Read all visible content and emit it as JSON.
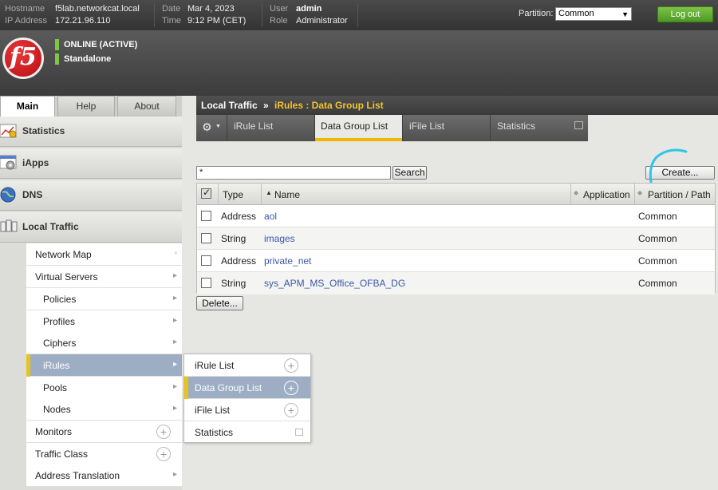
{
  "topbar": {
    "hostname_label": "Hostname",
    "hostname": "f5lab.networkcat.local",
    "ip_label": "IP Address",
    "ip": "172.21.96.110",
    "date_label": "Date",
    "date": "Mar 4, 2023",
    "time_label": "Time",
    "time": "9:12 PM (CET)",
    "user_label": "User",
    "user": "admin",
    "role_label": "Role",
    "role": "Administrator",
    "partition_label": "Partition:",
    "partition_value": "Common",
    "logout_label": "Log out"
  },
  "header": {
    "logo_text": "f5",
    "status_1": "ONLINE (ACTIVE)",
    "status_2": "Standalone"
  },
  "main_tabs": [
    "Main",
    "Help",
    "About"
  ],
  "sidebar": {
    "sections": [
      "Statistics",
      "iApps",
      "DNS",
      "Local Traffic"
    ],
    "items": [
      "Network Map",
      "Virtual Servers",
      "Policies",
      "Profiles",
      "Ciphers",
      "iRules",
      "Pools",
      "Nodes",
      "Monitors",
      "Traffic Class",
      "Address Translation"
    ]
  },
  "flyout": {
    "items": [
      "iRule List",
      "Data Group List",
      "iFile List",
      "Statistics"
    ]
  },
  "breadcrumb": {
    "root": "Local Traffic",
    "sep": "»",
    "current": "iRules : Data Group List"
  },
  "subtabs": [
    "iRule List",
    "Data Group List",
    "iFile List",
    "Statistics"
  ],
  "search": {
    "value": "*",
    "button": "Search"
  },
  "create_button": "Create...",
  "table": {
    "headers": {
      "type": "Type",
      "name": "Name",
      "application": "Application",
      "partition": "Partition / Path"
    },
    "rows": [
      {
        "type": "Address",
        "name": "aol",
        "application": "",
        "partition": "Common"
      },
      {
        "type": "String",
        "name": "images",
        "application": "",
        "partition": "Common"
      },
      {
        "type": "Address",
        "name": "private_net",
        "application": "",
        "partition": "Common"
      },
      {
        "type": "String",
        "name": "sys_APM_MS_Office_OFBA_DG",
        "application": "",
        "partition": "Common"
      }
    ]
  },
  "delete_button": "Delete...",
  "colors": {
    "accent": "#f0b800",
    "logout": "#4c9a22",
    "selected": "#9daec4",
    "annotation": "#2ec5e8"
  }
}
